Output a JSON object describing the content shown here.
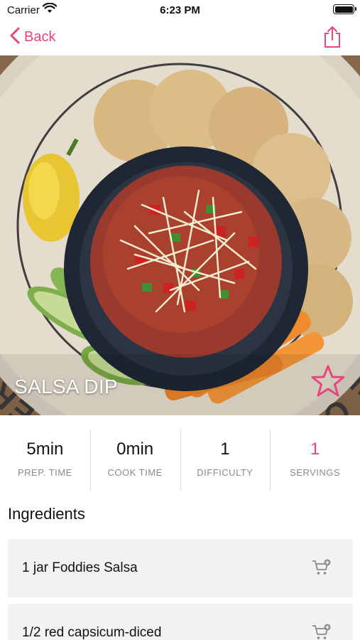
{
  "status_bar": {
    "carrier": "Carrier",
    "time": "6:23 PM"
  },
  "nav": {
    "back_label": "Back",
    "accent_color": "#e8457f",
    "share_icon": "share-icon"
  },
  "hero": {
    "title": "SALSA DIP",
    "board_text": "CAMEMBERT GOUDA SWISS CHEDDAR EDAM GORGONZOLA PARMESAN BRIE COLBY",
    "favorite_icon": "star-outline-icon"
  },
  "stats": [
    {
      "value": "5min",
      "label": "PREP. TIME"
    },
    {
      "value": "0min",
      "label": "COOK TIME"
    },
    {
      "value": "1",
      "label": "DIFFICULTY"
    },
    {
      "value": "1",
      "label": "SERVINGS"
    }
  ],
  "ingredients": {
    "heading": "Ingredients",
    "items": [
      {
        "text": "1 jar Foddies Salsa",
        "icon": "cart-add-icon"
      },
      {
        "text": "1/2 red capsicum-diced",
        "icon": "cart-add-icon"
      }
    ]
  }
}
